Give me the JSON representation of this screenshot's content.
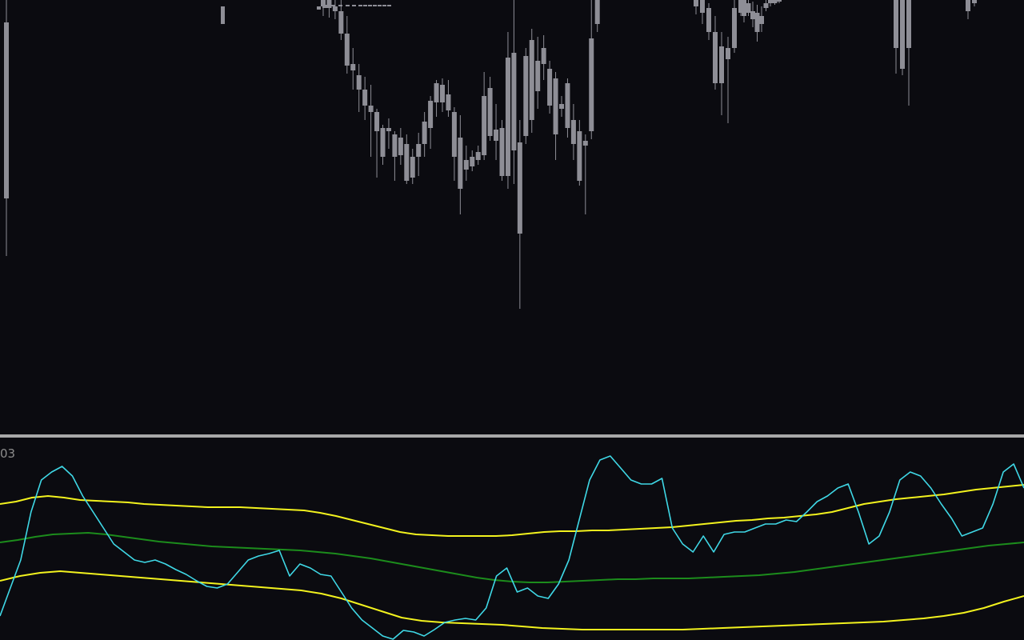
{
  "indicator": {
    "label": "03"
  },
  "colors": {
    "background": "#0b0b10",
    "candle": "#8e8e96",
    "separator": "#a8a8a8",
    "oscillator": "#3fd8e6",
    "band_outer": "#f2f21e",
    "band_middle": "#1c8c1c"
  },
  "chart_data": [
    {
      "type": "candlestick",
      "title": "",
      "candles": [
        [
          0,
          0,
          28,
          248,
          -140,
          320
        ],
        [
          1,
          6,
          -4,
          18,
          -120,
          20
        ],
        [
          2,
          24,
          -4,
          0,
          -120,
          10
        ],
        [
          3,
          1,
          -6,
          -2,
          -120,
          6
        ],
        [
          4,
          22,
          -6,
          -2,
          -120,
          12
        ],
        [
          5,
          42,
          -6,
          -4,
          -120,
          8
        ],
        [
          6,
          92,
          -6,
          -4,
          -120,
          10
        ],
        [
          7,
          150,
          -6,
          -4,
          -120,
          14
        ],
        [
          8,
          175,
          -6,
          -4,
          -120,
          10
        ],
        [
          9,
          210,
          -6,
          -4,
          -120,
          8
        ],
        [
          10,
          240,
          -6,
          -4,
          -120,
          12
        ],
        [
          11,
          260,
          -6,
          -4,
          -120,
          16
        ],
        [
          12,
          280,
          -6,
          -4,
          -120,
          10
        ],
        [
          13,
          300,
          -6,
          -4,
          -120,
          8
        ],
        [
          14,
          330,
          -6,
          -4,
          -120,
          6
        ],
        [
          15,
          360,
          -6,
          -4,
          -120,
          8
        ],
        [
          16,
          0,
          8,
          0,
          -20,
          20
        ],
        [
          17,
          0,
          -2,
          10,
          -18,
          22
        ],
        [
          18,
          0,
          8,
          14,
          -8,
          24
        ],
        [
          19,
          0,
          14,
          42,
          -4,
          50
        ],
        [
          20,
          0,
          42,
          82,
          20,
          92
        ],
        [
          21,
          0,
          80,
          88,
          60,
          112
        ],
        [
          22,
          0,
          94,
          112,
          80,
          140
        ],
        [
          23,
          0,
          112,
          132,
          96,
          150
        ],
        [
          24,
          0,
          132,
          140,
          106,
          196
        ],
        [
          25,
          0,
          140,
          164,
          136,
          222
        ],
        [
          26,
          0,
          160,
          196,
          156,
          206
        ],
        [
          27,
          0,
          160,
          164,
          148,
          186
        ],
        [
          28,
          0,
          168,
          196,
          164,
          226
        ],
        [
          29,
          0,
          172,
          194,
          160,
          206
        ],
        [
          30,
          0,
          180,
          226,
          168,
          230
        ],
        [
          31,
          0,
          196,
          222,
          186,
          230
        ],
        [
          32,
          0,
          180,
          196,
          166,
          220
        ],
        [
          33,
          0,
          152,
          180,
          140,
          196
        ],
        [
          34,
          0,
          126,
          160,
          120,
          186
        ],
        [
          35,
          0,
          104,
          128,
          100,
          146
        ],
        [
          36,
          0,
          106,
          128,
          98,
          140
        ],
        [
          37,
          0,
          118,
          138,
          100,
          146
        ],
        [
          38,
          0,
          140,
          196,
          134,
          226
        ],
        [
          39,
          0,
          172,
          236,
          144,
          268
        ],
        [
          40,
          0,
          200,
          212,
          182,
          226
        ],
        [
          41,
          0,
          196,
          208,
          188,
          214
        ],
        [
          42,
          0,
          190,
          200,
          182,
          206
        ],
        [
          43,
          0,
          120,
          194,
          90,
          200
        ],
        [
          44,
          0,
          110,
          170,
          96,
          176
        ],
        [
          45,
          0,
          162,
          176,
          130,
          200
        ],
        [
          46,
          0,
          160,
          220,
          150,
          226
        ],
        [
          47,
          0,
          72,
          220,
          40,
          236
        ],
        [
          48,
          0,
          66,
          188,
          -8,
          230
        ],
        [
          49,
          0,
          178,
          292,
          150,
          386
        ],
        [
          50,
          0,
          70,
          170,
          60,
          180
        ],
        [
          51,
          0,
          50,
          150,
          36,
          166
        ],
        [
          52,
          0,
          76,
          114,
          46,
          136
        ],
        [
          53,
          0,
          60,
          80,
          44,
          100
        ],
        [
          54,
          0,
          86,
          132,
          76,
          142
        ],
        [
          55,
          0,
          98,
          168,
          90,
          200
        ],
        [
          56,
          0,
          130,
          136,
          120,
          146
        ],
        [
          57,
          0,
          104,
          160,
          98,
          172
        ],
        [
          58,
          0,
          150,
          180,
          130,
          200
        ],
        [
          59,
          0,
          164,
          226,
          150,
          232
        ],
        [
          60,
          0,
          176,
          182,
          168,
          268
        ],
        [
          61,
          0,
          48,
          164,
          -20,
          174
        ],
        [
          62,
          0,
          -10,
          30,
          -30,
          40
        ],
        [
          63,
          0,
          -6,
          8,
          -20,
          18
        ],
        [
          64,
          0,
          -4,
          16,
          -10,
          30
        ],
        [
          65,
          0,
          10,
          40,
          4,
          50
        ],
        [
          66,
          0,
          40,
          104,
          20,
          112
        ],
        [
          67,
          0,
          58,
          104,
          40,
          144
        ],
        [
          68,
          0,
          60,
          74,
          46,
          154
        ],
        [
          69,
          0,
          10,
          60,
          -6,
          66
        ],
        [
          70,
          0,
          -4,
          16,
          -10,
          20
        ],
        [
          71,
          0,
          -2,
          20,
          -8,
          28
        ],
        [
          72,
          0,
          4,
          16,
          -4,
          20
        ],
        [
          73,
          0,
          14,
          24,
          2,
          34
        ],
        [
          74,
          0,
          16,
          40,
          6,
          52
        ],
        [
          75,
          0,
          20,
          30,
          8,
          40
        ],
        [
          76,
          0,
          4,
          10,
          -4,
          14
        ],
        [
          77,
          0,
          -4,
          4,
          -10,
          8
        ],
        [
          78,
          0,
          -4,
          4,
          -10,
          6
        ],
        [
          79,
          0,
          -4,
          0,
          -10,
          4
        ],
        [
          80,
          0,
          -6,
          60,
          -10,
          92
        ],
        [
          81,
          0,
          -4,
          86,
          -20,
          94
        ],
        [
          82,
          0,
          -4,
          60,
          -20,
          132
        ],
        [
          83,
          0,
          -4,
          14,
          -20,
          24
        ],
        [
          84,
          0,
          -4,
          4,
          -10,
          8
        ]
      ]
    },
    {
      "type": "line",
      "title": "",
      "series": [
        {
          "role": "oscillator",
          "values": [
            770,
            735,
            700,
            640,
            600,
            590,
            583,
            595,
            620,
            640,
            660,
            680,
            690,
            700,
            703,
            700,
            705,
            712,
            718,
            726,
            733,
            735,
            730,
            715,
            700,
            695,
            692,
            688,
            720,
            705,
            710,
            718,
            720,
            740,
            760,
            775,
            785,
            795,
            800,
            788,
            790,
            795,
            787,
            778,
            775,
            773,
            775,
            760,
            720,
            710,
            740,
            735,
            745,
            748,
            730,
            700,
            650,
            600,
            575,
            570,
            585,
            600,
            605,
            605,
            598,
            660,
            680,
            690,
            670,
            690,
            668,
            665,
            665,
            660,
            655,
            655,
            650,
            652,
            640,
            627,
            620,
            610,
            605,
            640,
            680,
            670,
            640,
            600,
            590,
            595,
            610,
            630,
            648,
            670,
            665,
            660,
            630,
            590,
            580,
            610
          ]
        },
        {
          "role": "upper-band",
          "values": [
            630,
            627,
            622,
            620,
            622,
            625,
            626,
            627,
            628,
            630,
            631,
            632,
            633,
            634,
            634,
            634,
            635,
            636,
            637,
            638,
            641,
            645,
            650,
            655,
            660,
            665,
            668,
            669,
            670,
            670,
            670,
            670,
            669,
            667,
            665,
            664,
            664,
            663,
            663,
            662,
            661,
            660,
            659,
            657,
            655,
            653,
            651,
            650,
            648,
            647,
            645,
            643,
            640,
            635,
            630,
            627,
            624,
            622,
            620,
            618,
            615,
            612,
            610,
            608,
            606
          ]
        },
        {
          "role": "middle-band",
          "values": [
            678,
            675,
            671,
            668,
            667,
            666,
            668,
            671,
            674,
            677,
            679,
            681,
            683,
            684,
            685,
            686,
            687,
            688,
            690,
            692,
            695,
            698,
            702,
            706,
            710,
            714,
            718,
            722,
            725,
            727,
            728,
            728,
            727,
            726,
            725,
            724,
            724,
            723,
            723,
            723,
            722,
            721,
            720,
            719,
            717,
            715,
            712,
            709,
            706,
            703,
            700,
            697,
            694,
            691,
            688,
            685,
            682,
            680,
            678
          ]
        },
        {
          "role": "lower-band",
          "values": [
            726,
            720,
            716,
            714,
            716,
            718,
            720,
            722,
            724,
            726,
            728,
            730,
            732,
            734,
            736,
            738,
            742,
            748,
            756,
            764,
            772,
            776,
            778,
            779,
            780,
            781,
            783,
            785,
            786,
            787,
            787,
            787,
            787,
            787,
            787,
            786,
            785,
            784,
            783,
            782,
            781,
            780,
            779,
            778,
            777,
            775,
            773,
            770,
            766,
            760,
            752,
            745
          ]
        }
      ]
    }
  ]
}
